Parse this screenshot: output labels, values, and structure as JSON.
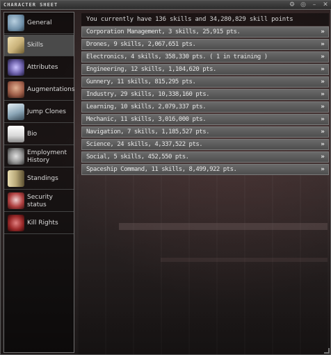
{
  "window": {
    "title": "CHARACTER SHEET"
  },
  "titlebar_buttons": [
    {
      "icon": "gear-icon",
      "glyph": "⚙"
    },
    {
      "icon": "circle-icon",
      "glyph": "◎"
    },
    {
      "icon": "minimize-icon",
      "glyph": "–"
    },
    {
      "icon": "close-icon",
      "glyph": "✕"
    }
  ],
  "sidebar": {
    "items": [
      {
        "label": "General",
        "icon": "general-icon",
        "color": "#6f8fa8",
        "active": false
      },
      {
        "label": "Skills",
        "icon": "skills-icon",
        "color": "#c9b27a",
        "active": true
      },
      {
        "label": "Attributes",
        "icon": "attributes-icon",
        "color": "#6b5fa8",
        "active": false
      },
      {
        "label": "Augmentations",
        "icon": "augmentations-icon",
        "color": "#a05f4a",
        "active": false
      },
      {
        "label": "Jump Clones",
        "icon": "jump-clones-icon",
        "color": "#8ca7b8",
        "active": false
      },
      {
        "label": "Bio",
        "icon": "bio-icon",
        "color": "#d8d8d8",
        "active": false
      },
      {
        "label": "Employment History",
        "icon": "employment-history-icon",
        "color": "#9a9a9a",
        "active": false
      },
      {
        "label": "Standings",
        "icon": "standings-icon",
        "color": "#b8a878",
        "active": false
      },
      {
        "label": "Security status",
        "icon": "security-status-icon",
        "color": "#b04040",
        "active": false
      },
      {
        "label": "Kill Rights",
        "icon": "kill-rights-icon",
        "color": "#9c2a2a",
        "active": false
      }
    ]
  },
  "main": {
    "header": "You currently have 136 skills and 34,280,829 skill points",
    "skill_groups": [
      "Corporation Management, 3 skills, 25,915 pts.",
      "Drones, 9 skills, 2,067,651 pts.",
      "Electronics, 4 skills, 358,330 pts. ( 1 in training )",
      "Engineering, 12 skills, 1,104,620 pts.",
      "Gunnery, 11 skills, 815,295 pts.",
      "Industry, 29 skills, 10,338,160 pts.",
      "Learning, 10 skills, 2,079,337 pts.",
      "Mechanic, 11 skills, 3,016,000 pts.",
      "Navigation, 7 skills, 1,185,527 pts.",
      "Science, 24 skills, 4,337,522 pts.",
      "Social, 5 skills, 452,550 pts.",
      "Spaceship Command, 11 skills, 8,499,922 pts."
    ],
    "expand_glyph": "»"
  }
}
